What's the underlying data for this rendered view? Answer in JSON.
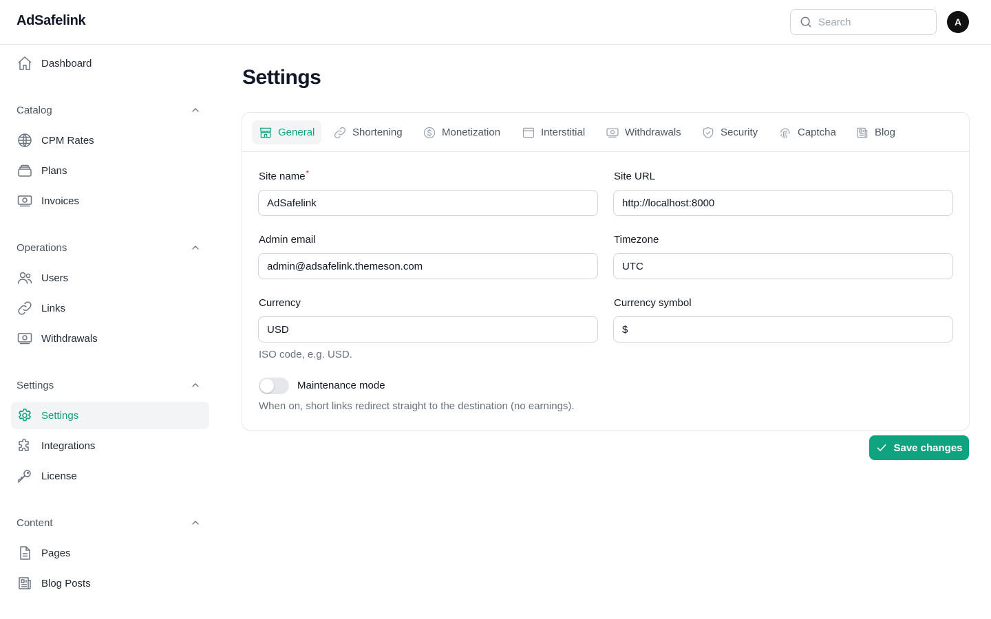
{
  "app": {
    "brand": "AdSafelink"
  },
  "header": {
    "search_placeholder": "Search",
    "search_value": "",
    "avatar_initial": "A"
  },
  "sidebar": {
    "dashboard": {
      "label": "Dashboard",
      "icon": "home-icon"
    },
    "groups": [
      {
        "title": "Catalog",
        "items": [
          {
            "label": "CPM Rates",
            "icon": "globe-icon"
          },
          {
            "label": "Plans",
            "icon": "stack-icon"
          },
          {
            "label": "Invoices",
            "icon": "banknote-icon"
          }
        ]
      },
      {
        "title": "Operations",
        "items": [
          {
            "label": "Users",
            "icon": "users-icon"
          },
          {
            "label": "Links",
            "icon": "link-icon"
          },
          {
            "label": "Withdrawals",
            "icon": "banknote-icon"
          }
        ]
      },
      {
        "title": "Settings",
        "items": [
          {
            "label": "Settings",
            "icon": "gear-icon",
            "active": true
          },
          {
            "label": "Integrations",
            "icon": "puzzle-icon"
          },
          {
            "label": "License",
            "icon": "key-icon"
          }
        ]
      },
      {
        "title": "Content",
        "items": [
          {
            "label": "Pages",
            "icon": "document-icon"
          },
          {
            "label": "Blog Posts",
            "icon": "newspaper-icon"
          }
        ]
      }
    ]
  },
  "main": {
    "title": "Settings",
    "tabs": [
      {
        "label": "General",
        "icon": "storefront-icon",
        "active": true
      },
      {
        "label": "Shortening",
        "icon": "link-icon"
      },
      {
        "label": "Monetization",
        "icon": "dollar-circle-icon"
      },
      {
        "label": "Interstitial",
        "icon": "window-icon"
      },
      {
        "label": "Withdrawals",
        "icon": "banknote-icon"
      },
      {
        "label": "Security",
        "icon": "shield-check-icon"
      },
      {
        "label": "Captcha",
        "icon": "fingerprint-icon"
      },
      {
        "label": "Blog",
        "icon": "newspaper-icon"
      }
    ],
    "form": {
      "site_name": {
        "label": "Site name",
        "required_mark": "*",
        "value": "AdSafelink"
      },
      "site_url": {
        "label": "Site URL",
        "value": "http://localhost:8000"
      },
      "admin_email": {
        "label": "Admin email",
        "value": "admin@adsafelink.themeson.com"
      },
      "timezone": {
        "label": "Timezone",
        "value": "UTC"
      },
      "currency": {
        "label": "Currency",
        "value": "USD",
        "hint": "ISO code, e.g. USD."
      },
      "currency_symbol": {
        "label": "Currency symbol",
        "value": "$"
      },
      "maintenance": {
        "label": "Maintenance mode",
        "enabled": false,
        "hint": "When on, short links redirect straight to the destination (no earnings)."
      }
    },
    "save_label": "Save changes"
  },
  "colors": {
    "accent": "#10a37f",
    "border": "#e5e7eb",
    "muted_text": "#6b7280",
    "required": "#dc2626",
    "avatar_bg": "#111111"
  }
}
